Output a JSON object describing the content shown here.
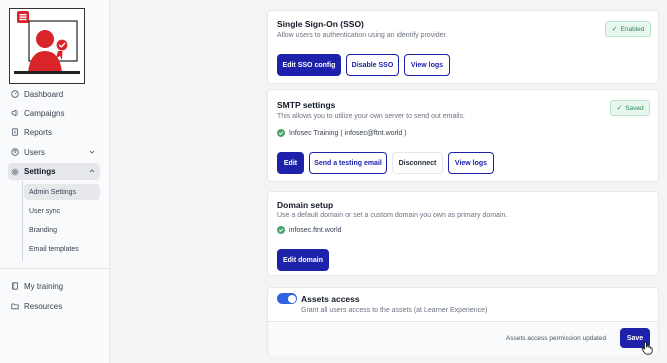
{
  "sidebar": {
    "nav": [
      {
        "label": "Dashboard",
        "icon": "gauge-icon"
      },
      {
        "label": "Campaigns",
        "icon": "megaphone-icon"
      },
      {
        "label": "Reports",
        "icon": "document-icon"
      },
      {
        "label": "Users",
        "icon": "user-icon"
      },
      {
        "label": "Settings",
        "icon": "gear-icon"
      }
    ],
    "settings_sub": [
      "Admin Settings",
      "User sync",
      "Branding",
      "Email templates"
    ],
    "bottom": [
      {
        "label": "My training",
        "icon": "book-icon"
      },
      {
        "label": "Resources",
        "icon": "folder-icon"
      }
    ]
  },
  "sso": {
    "title": "Single Sign-On (SSO)",
    "desc": "Allow users to authentication using an identify provider.",
    "badge": "Enabled",
    "buttons": [
      "Edit SSO config",
      "Disable SSO",
      "View logs"
    ]
  },
  "smtp": {
    "title": "SMTP settings",
    "desc": "This allows you to utilize your own server to send out emails.",
    "badge": "Saved",
    "sender": "Infosec Training ( infosec@ftnt.world )",
    "buttons": [
      "Edit",
      "Send a testing email",
      "Disconnect",
      "View logs"
    ]
  },
  "domain": {
    "title": "Domain setup",
    "desc": "Use a default domain or set a custom domain you own as primary domain.",
    "value": "infosec.ftnt.world",
    "button": "Edit domain"
  },
  "assets": {
    "title": "Assets access",
    "desc": "Grant all users access to the assets (at Learner Experience)",
    "toggle_on": true,
    "status": "Assets access permission updated",
    "button": "Save"
  },
  "colors": {
    "primary": "#1e22aa",
    "toggle": "#2b63e0",
    "success": "#2f8a57",
    "logo_red": "#d9252a"
  }
}
